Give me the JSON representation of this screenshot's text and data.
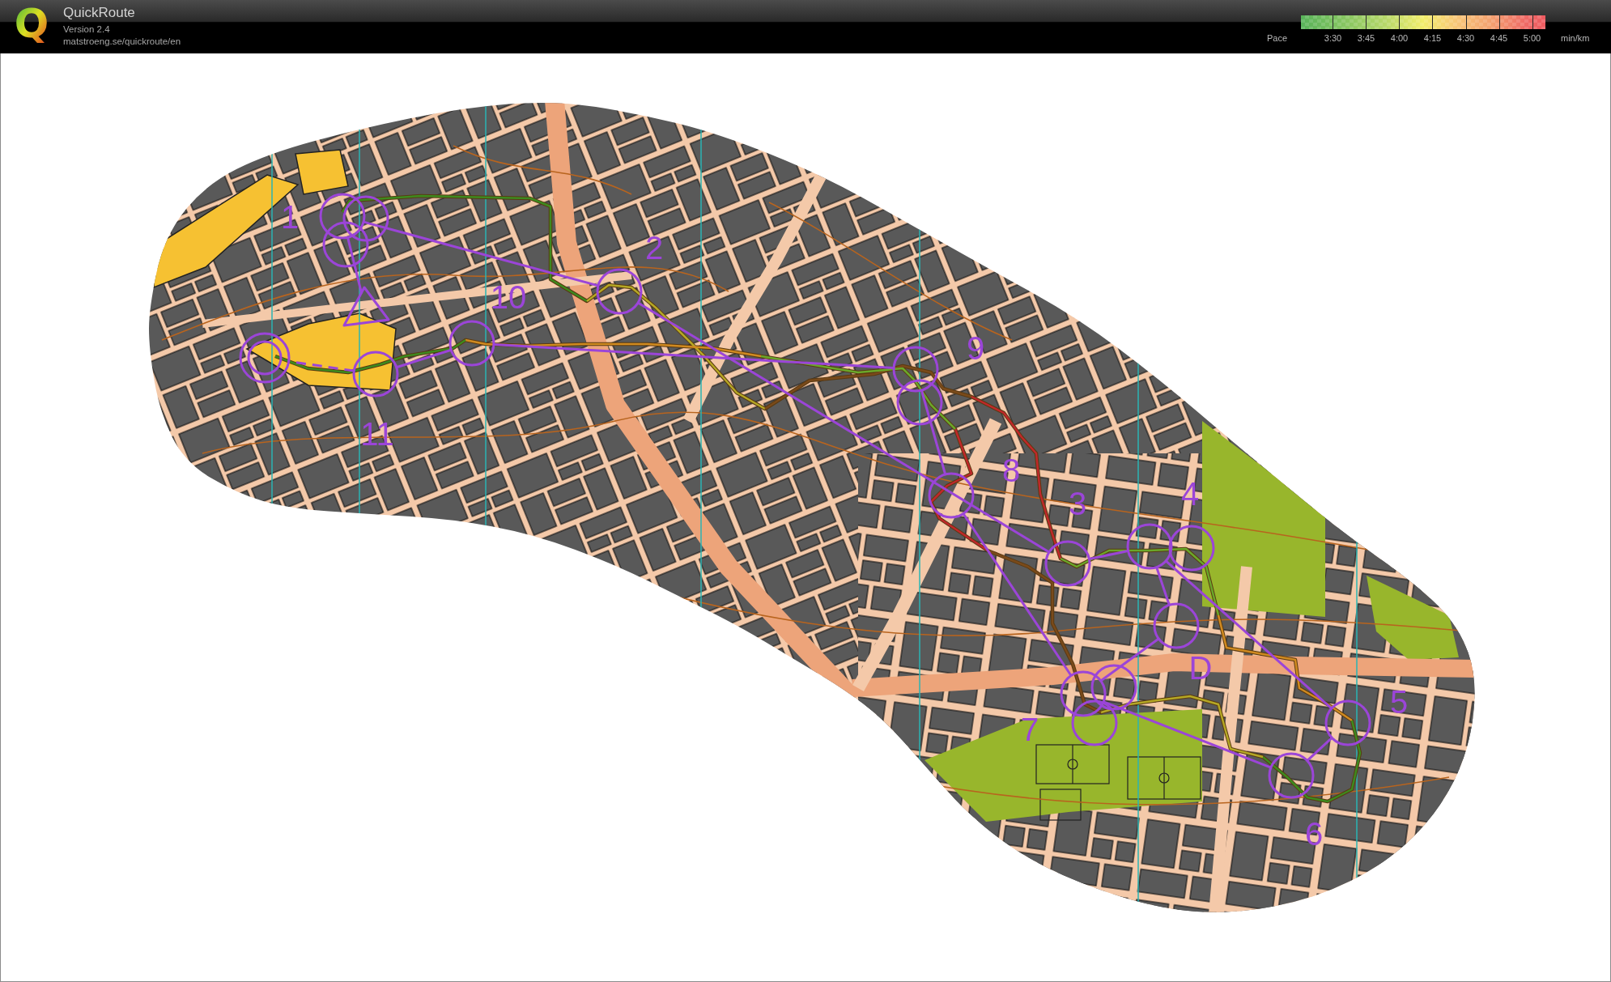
{
  "app": {
    "logo": "Q",
    "title": "QuickRoute",
    "version": "Version 2.4",
    "url": "matstroeng.se/quickroute/en"
  },
  "pace_legend": {
    "label": "Pace",
    "ticks": [
      "3:30",
      "3:45",
      "4:00",
      "4:15",
      "4:30",
      "4:45",
      "5:00"
    ],
    "unit": "min/km"
  },
  "map": {
    "controls": [
      {
        "kind": "start"
      },
      {
        "kind": "control",
        "label": "1"
      },
      {
        "kind": "control",
        "label": "2"
      },
      {
        "kind": "control",
        "label": "3"
      },
      {
        "kind": "control",
        "label": "4"
      },
      {
        "kind": "control",
        "label": "5"
      },
      {
        "kind": "control",
        "label": "6"
      },
      {
        "kind": "control",
        "label": "7"
      },
      {
        "kind": "control",
        "label": "8"
      },
      {
        "kind": "control",
        "label": "9"
      },
      {
        "kind": "control",
        "label": "10"
      },
      {
        "kind": "control",
        "label": "11"
      },
      {
        "kind": "control",
        "label": "D"
      },
      {
        "kind": "finish"
      }
    ]
  }
}
